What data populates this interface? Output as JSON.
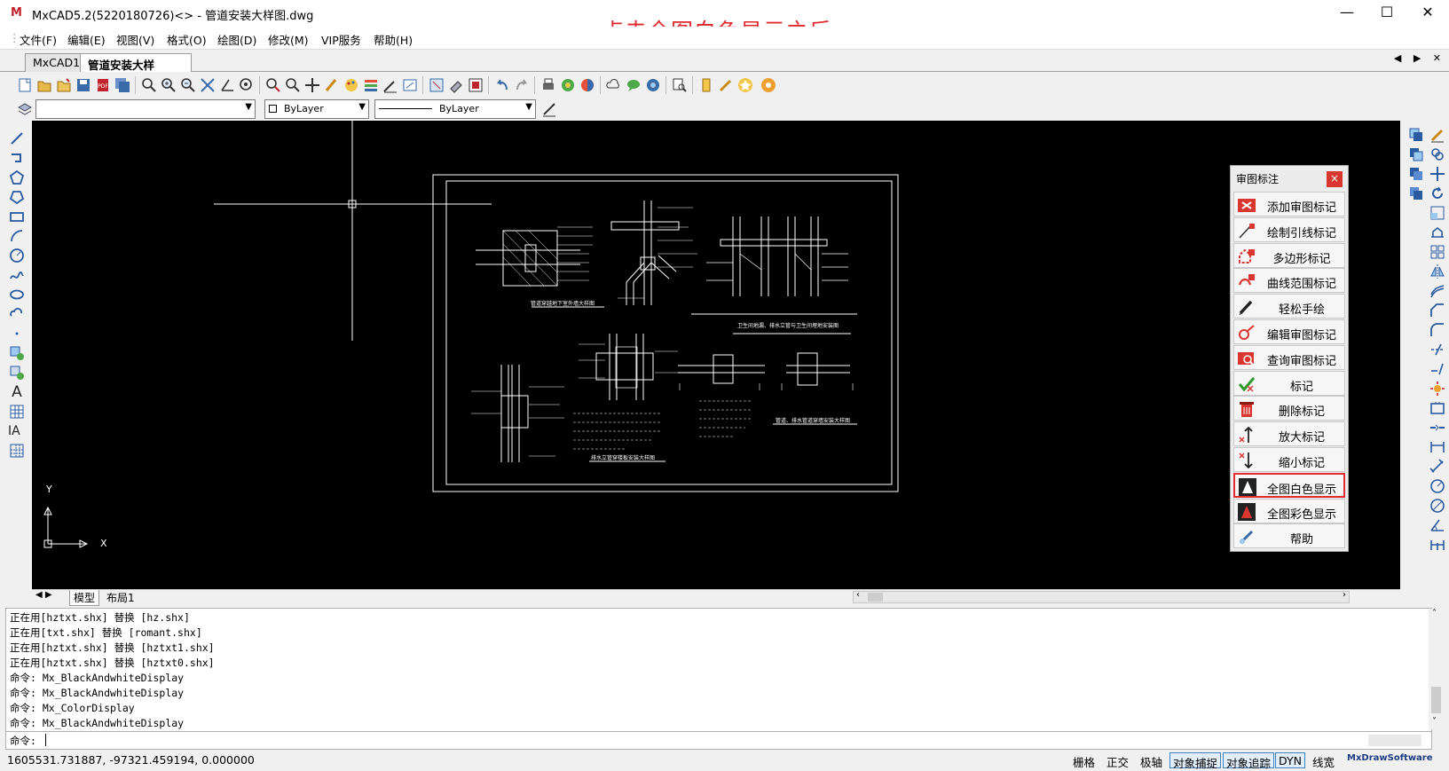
{
  "window": {
    "title": "MxCAD5.2(5220180726)<> - 管道安装大样图.dwg",
    "annotation": "点击全图白色显示之后",
    "controls": {
      "minimize": "—",
      "maximize": "☐",
      "close": "✕"
    }
  },
  "menubar": {
    "items": [
      {
        "label": "文件(F)"
      },
      {
        "label": "编辑(E)"
      },
      {
        "label": "视图(V)"
      },
      {
        "label": "格式(O)"
      },
      {
        "label": "绘图(D)"
      },
      {
        "label": "修改(M)"
      },
      {
        "label": "VIP服务"
      },
      {
        "label": "帮助(H)"
      }
    ]
  },
  "tabs": {
    "items": [
      {
        "label": "MxCAD1",
        "active": false
      },
      {
        "label": "管道安装大样图.dwg",
        "active": true
      }
    ],
    "nav": "◀ ▶ ✕"
  },
  "properties": {
    "layer": "",
    "color": "ByLayer",
    "linetype": "ByLayer"
  },
  "review_panel": {
    "title": "审图标注",
    "close": "×",
    "buttons": [
      {
        "label": "添加审图标记",
        "icon": "add-mark-icon"
      },
      {
        "label": "绘制引线标记",
        "icon": "leader-mark-icon"
      },
      {
        "label": "多边形标记",
        "icon": "polygon-mark-icon"
      },
      {
        "label": "曲线范围标记",
        "icon": "curve-mark-icon"
      },
      {
        "label": "轻松手绘",
        "icon": "pen-icon"
      },
      {
        "label": "编辑审图标记",
        "icon": "edit-mark-icon"
      },
      {
        "label": "查询审图标记",
        "icon": "query-mark-icon"
      },
      {
        "label": "标记",
        "icon": "check-icon"
      },
      {
        "label": "删除标记",
        "icon": "delete-icon"
      },
      {
        "label": "放大标记",
        "icon": "enlarge-icon"
      },
      {
        "label": "缩小标记",
        "icon": "shrink-icon"
      },
      {
        "label": "全图白色显示",
        "icon": "white-display-icon",
        "selected": true
      },
      {
        "label": "全图彩色显示",
        "icon": "color-display-icon"
      },
      {
        "label": "帮助",
        "icon": "help-icon"
      }
    ]
  },
  "drawing": {
    "ucs_y": "Y",
    "ucs_x": "X",
    "labels": {
      "d1": "管道穿越地下室外墙大样图",
      "d2": "卫生间地漏、排水立管与卫生间埋地安装图",
      "d3": "排水立管穿楼板安装大样图",
      "d4": "管道、排水管道穿墙安装大样图"
    }
  },
  "layout_tabs": {
    "model": "模型",
    "layout1": "布局1"
  },
  "command": {
    "history": [
      "正在用[hztxt.shx] 替换 [hz.shx]",
      "正在用[txt.shx] 替换 [romant.shx]",
      "正在用[hztxt.shx] 替换 [hztxt1.shx]",
      "正在用[hztxt.shx] 替换 [hztxt0.shx]",
      "命令: Mx_BlackAndwhiteDisplay",
      "命令: Mx_BlackAndwhiteDisplay",
      "命令: Mx_ColorDisplay",
      "命令: Mx_BlackAndwhiteDisplay"
    ],
    "prompt": "命令:"
  },
  "status": {
    "coords": "1605531.731887,  -97321.459194,  0.000000",
    "toggles": [
      {
        "label": "栅格",
        "on": false
      },
      {
        "label": "正交",
        "on": false
      },
      {
        "label": "极轴",
        "on": false
      },
      {
        "label": "对象捕捉",
        "on": true
      },
      {
        "label": "对象追踪",
        "on": true
      },
      {
        "label": "DYN",
        "on": true
      },
      {
        "label": "线宽",
        "on": false
      }
    ],
    "brand": "MxDrawSoftware"
  },
  "colors": {
    "canvas": "#000000",
    "annotation": "#e0292c",
    "selected_border": "#e02b33"
  }
}
